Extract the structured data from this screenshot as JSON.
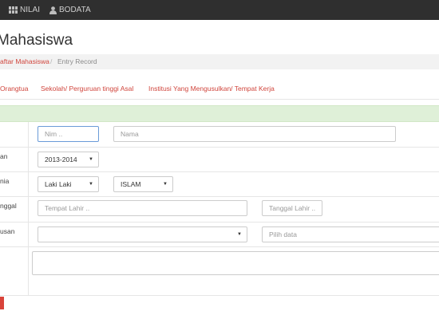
{
  "topnav": {
    "items": [
      {
        "label": "NILAI",
        "icon": "grid-icon"
      },
      {
        "label": "BODATA",
        "icon": "user-icon"
      }
    ]
  },
  "page": {
    "title": "Mahasiswa"
  },
  "breadcrumb": {
    "link": "aftar Mahasiswa",
    "separator": "/",
    "current": "Entry Record"
  },
  "tabs": [
    {
      "label": "Orangtua"
    },
    {
      "label": "Sekolah/ Perguruan tinggi Asal"
    },
    {
      "label": "Institusi Yang Mengusulkan/ Tempat Kerja"
    }
  ],
  "form": {
    "rows": [
      {
        "label": ""
      },
      {
        "label": "an"
      },
      {
        "label": "nia"
      },
      {
        "label": "nggal"
      },
      {
        "label": "usan"
      }
    ],
    "nim_placeholder": "Nim ..",
    "nama_placeholder": "Nama",
    "tahun_value": "2013-2014",
    "gender_value": "Laki Laki",
    "agama_value": "ISLAM",
    "tempat_lahir_placeholder": "Tempat Lahir ..",
    "tanggal_lahir_placeholder": "Tanggal Lahir ..",
    "jurusan_value": "",
    "pilih_data_placeholder": "Pilih data"
  },
  "colors": {
    "accent": "#d0453c",
    "topbar": "#2f2f2f",
    "success": "#dff0d8",
    "danger": "#d9433a"
  }
}
